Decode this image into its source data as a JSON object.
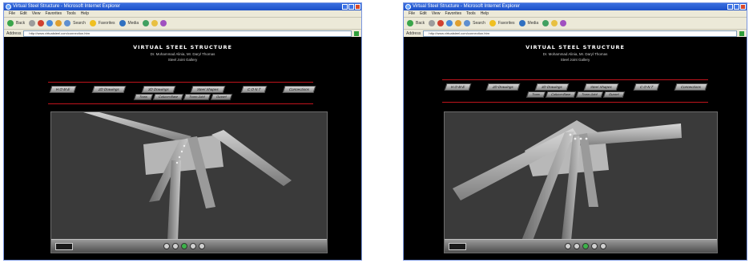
{
  "windows": [
    {
      "title": "Virtual Steel Structure - Microsoft Internet Explorer",
      "menu": [
        "File",
        "Edit",
        "View",
        "Favorites",
        "Tools",
        "Help"
      ],
      "toolbar": [
        "Back",
        "Search",
        "Favorites",
        "Media"
      ],
      "address_label": "Address",
      "address": "http://www.virtualsteel.com/connection.htm",
      "page": {
        "title": "VIRTUAL STEEL STRUCTURE",
        "subtitle1": "Dr. Mohammad Alinia, Mr. Daryl Thomas",
        "subtitle2": "Steel Joint Gallery",
        "nav": [
          "H O M E",
          "2D Drawings",
          "3D Drawings",
          "Steel Shapes",
          "C O N T",
          "Connections"
        ],
        "subnav": [
          "Truss",
          "Column-Base",
          "Truss-Joint",
          "Gusset"
        ]
      }
    },
    {
      "title": "Virtual Steel Structure - Microsoft Internet Explorer",
      "menu": [
        "File",
        "Edit",
        "View",
        "Favorites",
        "Tools",
        "Help"
      ],
      "toolbar": [
        "Back",
        "Search",
        "Favorites",
        "Media"
      ],
      "address_label": "Address",
      "address": "http://www.virtualsteel.com/connection.htm",
      "page": {
        "title": "VIRTUAL STEEL STRUCTURE",
        "subtitle1": "Dr. Mohammad Alinia, Mr. Daryl Thomas",
        "subtitle2": "Steel Joint Gallery",
        "nav": [
          "H O M E",
          "2D Drawings",
          "3D Drawings",
          "Steel Shapes",
          "C O N T",
          "Connections"
        ],
        "subnav": [
          "Truss",
          "Column-Base",
          "Truss-Joint",
          "Gusset"
        ]
      }
    }
  ],
  "colors": {
    "titlebar": "#245edc",
    "accent_line": "#c0141c",
    "page_bg": "#000000",
    "viewport_bg": "#3a3a3a"
  }
}
